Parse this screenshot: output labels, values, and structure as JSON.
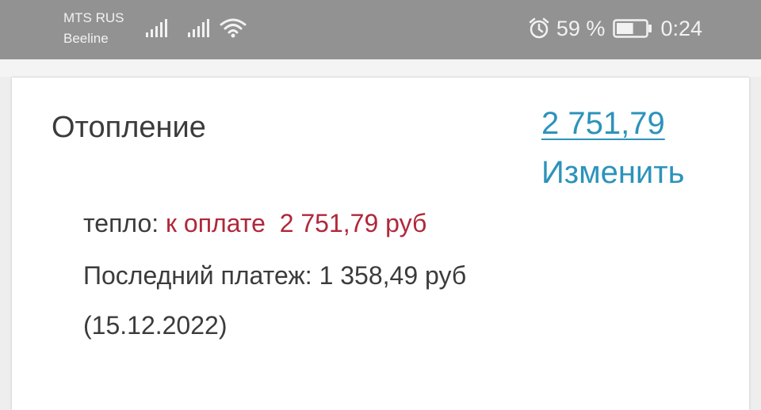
{
  "status_bar": {
    "carrier1": "MTS RUS",
    "carrier2": "Beeline",
    "battery_percent": "59 %",
    "battery_level": 0.59,
    "time": "0:24",
    "icons": [
      "signal-icon",
      "signal-icon",
      "wifi-icon",
      "alarm-icon",
      "battery-icon"
    ]
  },
  "card": {
    "title": "Отопление",
    "amount_link": "2 751,79",
    "change_link": "Изменить",
    "heat_label": "тепло:",
    "due_label": "к оплате",
    "due_amount": "2 751,79 руб",
    "last_payment_text": "Последний платеж: 1 358,49 руб",
    "last_payment_date": "(15.12.2022)"
  },
  "colors": {
    "status_bar_bg": "#929292",
    "link": "#2c93bb",
    "due": "#b0283a",
    "text": "#3b3b3b"
  }
}
